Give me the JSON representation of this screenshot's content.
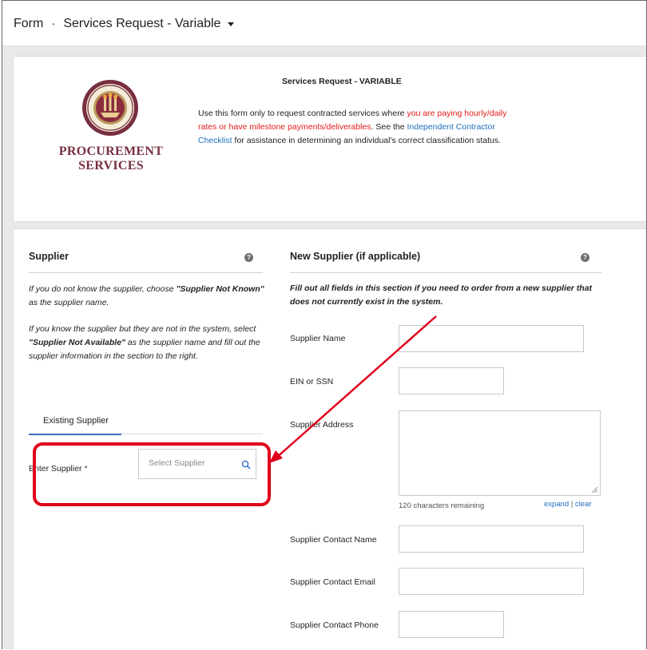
{
  "header": {
    "form_label": "Form",
    "separator": "·",
    "form_name": "Services Request - Variable"
  },
  "intro": {
    "logo_line1": "PROCUREMENT",
    "logo_line2": "SERVICES",
    "title": "Services Request - VARIABLE",
    "text_part1": "Use this form only to request contracted services where ",
    "text_red": "you are paying hourly/daily rates or have milestone payments/deliverables",
    "text_part2": ". See the ",
    "text_link": "Independent Contractor Checklist",
    "text_part3": " for assistance in determining an individual's correct classification status."
  },
  "supplier": {
    "title": "Supplier",
    "help_icon": "help-icon",
    "p1_a": "If you do not know the supplier, choose ",
    "p1_bold": "\"Supplier Not Known\"",
    "p1_b": " as the supplier name.",
    "p2_a": "If you know the supplier but they are not in the system, select ",
    "p2_bold": "\"Supplier Not Available\"",
    "p2_b": " as the supplier name and fill out the supplier information in the section to the right.",
    "tab_label": "Existing Supplier",
    "enter_label": "Enter Supplier",
    "required_mark": "*",
    "select_placeholder": "Select Supplier",
    "search_icon": "search-icon"
  },
  "new_supplier": {
    "title": "New Supplier (if applicable)",
    "help_icon": "help-icon",
    "instructions": "Fill out all fields in this section if you need to order from a new supplier that does not currently exist in the system.",
    "fields": {
      "name_label": "Supplier Name",
      "ein_label": "EIN or SSN",
      "address_label": "Supplier Address",
      "chars_remaining": "120 characters remaining",
      "expand_link": "expand",
      "divider": "|",
      "clear_link": "clear",
      "contact_name_label": "Supplier Contact Name",
      "contact_email_label": "Supplier Contact Email",
      "contact_phone_label": "Supplier Contact Phone"
    }
  },
  "annotation": {
    "highlight_color": "#e0001a",
    "arrow_color": "#e0001a"
  }
}
